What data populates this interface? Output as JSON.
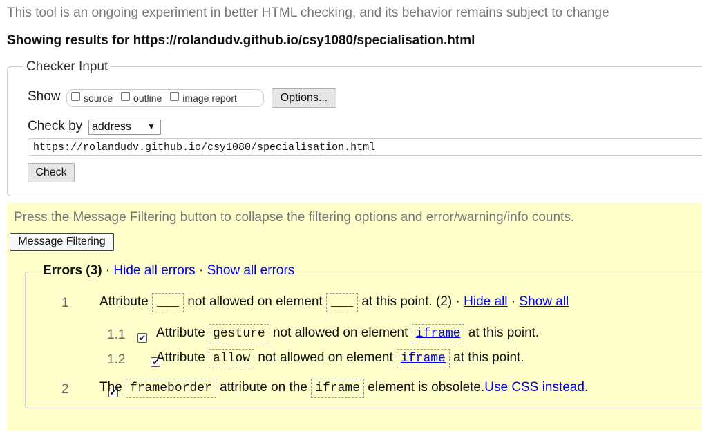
{
  "intro": "This tool is an ongoing experiment in better HTML checking, and its behavior remains subject to change",
  "results_heading": "Showing results for https://rolandudv.github.io/csy1080/specialisation.html",
  "checker": {
    "legend": "Checker Input",
    "show_label": "Show",
    "options": {
      "source": "source",
      "outline": "outline",
      "image_report": "image report"
    },
    "options_button": "Options...",
    "checkby_label": "Check by",
    "checkby_value": "address",
    "url": "https://rolandudv.github.io/csy1080/specialisation.html",
    "check_button": "Check"
  },
  "filter": {
    "notice": "Press the Message Filtering button to collapse the filtering options and error/warning/info counts.",
    "button": "Message Filtering"
  },
  "errors": {
    "title": "Errors (3)",
    "sep": "·",
    "hide_all_errors": "Hide all errors",
    "show_all_errors": "Show all errors",
    "group1": {
      "num": "1",
      "t1": "Attribute",
      "blank": "___",
      "t2": "not allowed on element",
      "t3": "at this point. (2)",
      "hide_all": "Hide all",
      "show_all": "Show all"
    },
    "item11": {
      "num": "1.1",
      "t1": "Attribute",
      "attr": "gesture",
      "t2": "not allowed on element",
      "element": "iframe",
      "t3": "at this point."
    },
    "item12": {
      "num": "1.2",
      "t1": "Attribute",
      "attr": "allow",
      "t2": "not allowed on element",
      "element": "iframe",
      "t3": "at this point."
    },
    "item2": {
      "num": "2",
      "t1": "The",
      "attr": "frameborder",
      "t2": "attribute on the",
      "element": "iframe",
      "t3": "element is obsolete.",
      "link": "Use CSS instead",
      "end": "."
    }
  },
  "check_mark": "✔",
  "dropdown_arrow": "▼"
}
